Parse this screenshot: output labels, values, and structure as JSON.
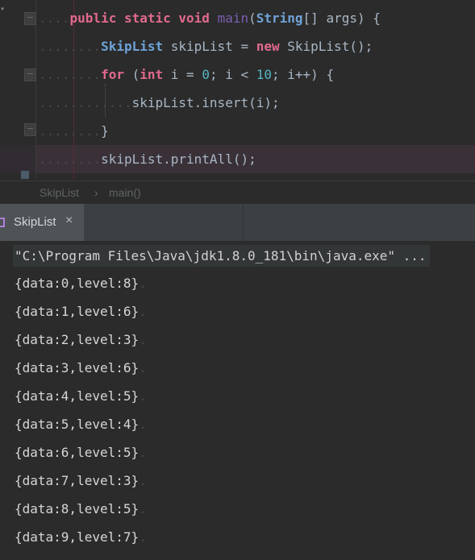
{
  "editor": {
    "lines": [
      {
        "dots": "....",
        "parts": [
          [
            "kw",
            "public"
          ],
          [
            "plain",
            " "
          ],
          [
            "kw",
            "static"
          ],
          [
            "plain",
            " "
          ],
          [
            "kw",
            "void"
          ],
          [
            "plain",
            " "
          ],
          [
            "fn",
            "main"
          ],
          [
            "plain",
            "("
          ],
          [
            "type",
            "String"
          ],
          [
            "plain",
            "[] args) {"
          ]
        ]
      },
      {
        "dots": "........",
        "parts": [
          [
            "type",
            "SkipList"
          ],
          [
            "plain",
            " skipList = "
          ],
          [
            "kw",
            "new"
          ],
          [
            "plain",
            " SkipList();"
          ]
        ]
      },
      {
        "dots": "........",
        "parts": [
          [
            "kw",
            "for"
          ],
          [
            "plain",
            " ("
          ],
          [
            "kw",
            "int"
          ],
          [
            "plain",
            " i = "
          ],
          [
            "num",
            "0"
          ],
          [
            "plain",
            "; i < "
          ],
          [
            "num",
            "10"
          ],
          [
            "plain",
            "; i++) {"
          ]
        ]
      },
      {
        "dots": "............",
        "parts": [
          [
            "plain",
            "skipList.insert(i);"
          ]
        ]
      },
      {
        "dots": "........",
        "parts": [
          [
            "plain",
            "}"
          ]
        ]
      },
      {
        "dots": "........",
        "parts": [
          [
            "plain",
            "skipList.printAll();"
          ]
        ]
      }
    ]
  },
  "breadcrumb": {
    "class_name": "SkipList",
    "separator": "›",
    "method": "main()"
  },
  "run_panel": {
    "tab_label": "SkipList",
    "tab_close": "×",
    "command": "\"C:\\Program Files\\Java\\jdk1.8.0_181\\bin\\java.exe\" ...",
    "output": [
      "{data:0,level:8}",
      "{data:1,level:6}",
      "{data:2,level:3}",
      "{data:3,level:6}",
      "{data:4,level:5}",
      "{data:5,level:4}",
      "{data:6,level:5}",
      "{data:7,level:3}",
      "{data:8,level:5}",
      "{data:9,level:7}"
    ],
    "output_tail": "."
  }
}
